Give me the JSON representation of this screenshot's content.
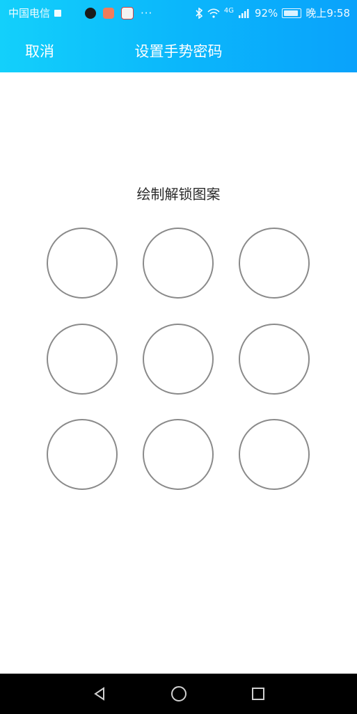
{
  "status_bar": {
    "carrier": "中国电信",
    "overflow": "···",
    "network": "4G",
    "battery": "92%",
    "time": "晚上9:58",
    "icons": [
      "tiktok-icon",
      "video-app-icon",
      "news-app-icon",
      "bluetooth-icon",
      "wifi-icon",
      "signal-icon",
      "battery-icon"
    ]
  },
  "header": {
    "cancel_label": "取消",
    "title": "设置手势密码",
    "background_start": "#13d0fb",
    "background_end": "#0aa2fb"
  },
  "main": {
    "prompt": "绘制解锁图案",
    "pattern_grid": {
      "rows": 3,
      "cols": 3,
      "dot_color": "#8a8a8a"
    }
  },
  "system_nav": {
    "buttons": [
      "back-icon",
      "home-icon",
      "recents-icon"
    ],
    "background": "#000000"
  }
}
